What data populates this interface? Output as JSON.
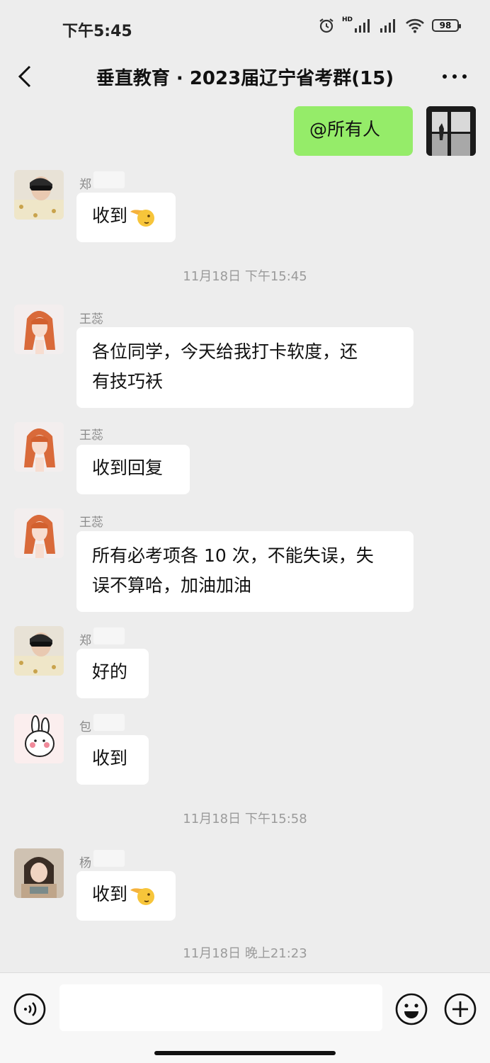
{
  "status": {
    "time": "下午5:45",
    "hd": "HD",
    "battery": "98"
  },
  "header": {
    "title": "垂直教育 · 2023届辽宁省考群(15)"
  },
  "messages": [
    {
      "side": "right",
      "text": "@所有人"
    },
    {
      "sender": "郑",
      "text": "收到"
    },
    {
      "timestamp": "11月18日 下午15:45"
    },
    {
      "sender": "王蕊",
      "text_line1": "各位同学，今天给我打卡软度，还",
      "text_line2": "有技巧袄"
    },
    {
      "sender": "王蕊",
      "text": "收到回复"
    },
    {
      "sender": "王蕊",
      "text_line1": "所有必考项各 10 次，不能失误，失",
      "text_line2": "误不算哈，加油加油"
    },
    {
      "sender": "郑",
      "text": "好的"
    },
    {
      "sender": "包",
      "text": "收到"
    },
    {
      "timestamp": "11月18日 下午15:58"
    },
    {
      "sender": "杨",
      "text": "收到"
    },
    {
      "timestamp": "11月18日 晚上21:23"
    }
  ],
  "icons": {
    "back": "chevron-left-icon",
    "more": "more-dots-icon",
    "voice": "voice-icon",
    "emoji": "smiley-icon",
    "plus": "plus-icon",
    "hand": "pointing-hand-emoji"
  },
  "colors": {
    "background": "#ededed",
    "my_bubble": "#95ec69",
    "their_bubble": "#ffffff"
  }
}
